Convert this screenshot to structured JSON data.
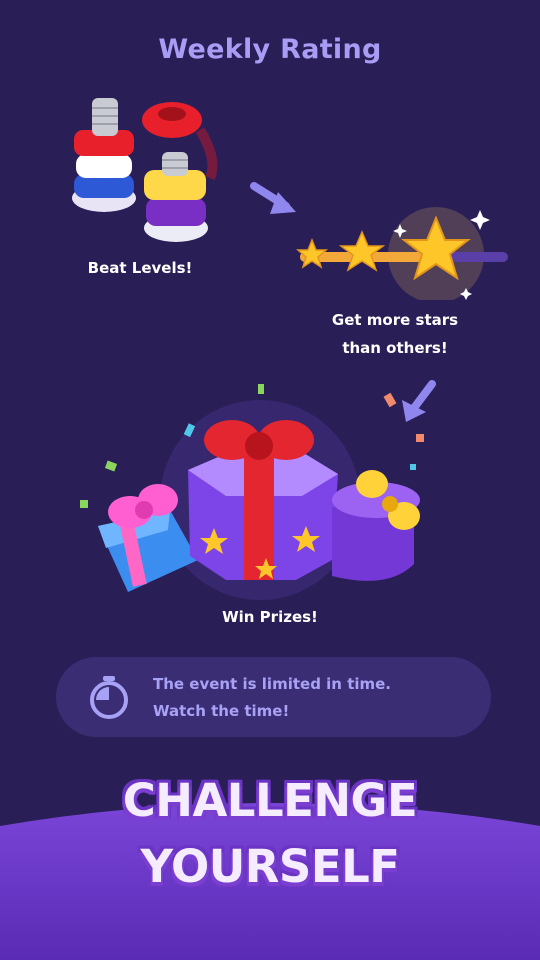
{
  "header": {
    "title": "Weekly Rating"
  },
  "steps": {
    "beat_levels": "Beat Levels!",
    "more_stars_line1": "Get more stars",
    "more_stars_line2": "than others!",
    "win_prizes": "Win Prizes!"
  },
  "timer_notice": {
    "icon": "stopwatch-icon",
    "line1": "The event is limited in time.",
    "line2": "Watch the time!"
  },
  "cta": {
    "line1": "CHALLENGE",
    "line2": "YOURSELF"
  },
  "colors": {
    "background": "#2a1e57",
    "title": "#a89cf5",
    "banner": "#3b2d73",
    "banner_text": "#a8a2f6",
    "cta_panel": "#6a38c9",
    "star": "#ffc629"
  }
}
